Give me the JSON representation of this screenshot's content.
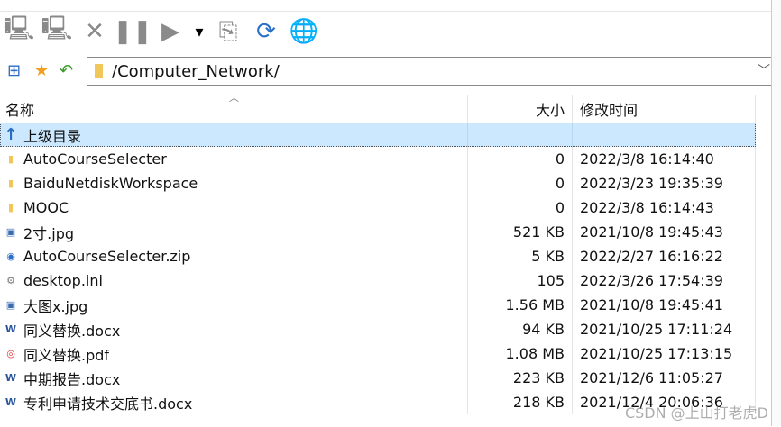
{
  "toolbar": {
    "buttons": [
      {
        "name": "connect-icon",
        "glyph": "🖳"
      },
      {
        "name": "disconnect-icon",
        "glyph": "🖳"
      },
      {
        "name": "stop-icon",
        "glyph": "✕"
      },
      {
        "name": "pause-icon",
        "glyph": "❚❚"
      },
      {
        "name": "play-icon",
        "glyph": "▶"
      },
      {
        "name": "dropdown-arrow-icon",
        "glyph": "▾"
      },
      {
        "name": "transfer-icon",
        "glyph": "⎘"
      },
      {
        "name": "refresh-icon",
        "glyph": "⟳"
      },
      {
        "name": "globe-icon",
        "glyph": "🌐"
      }
    ]
  },
  "address": {
    "path": "/Computer_Network/"
  },
  "columns": {
    "name": "名称",
    "size": "大小",
    "modified": "修改时间"
  },
  "parent": "上级目录",
  "files": [
    {
      "name": "AutoCourseSelecter",
      "size": "0",
      "modified": "2022/3/8 16:14:40",
      "type": "folder"
    },
    {
      "name": "BaiduNetdiskWorkspace",
      "size": "0",
      "modified": "2022/3/23 19:35:39",
      "type": "folder"
    },
    {
      "name": "MOOC",
      "size": "0",
      "modified": "2022/3/8 16:14:43",
      "type": "folder"
    },
    {
      "name": "2寸.jpg",
      "size": "521 KB",
      "modified": "2021/10/8 19:45:43",
      "type": "image"
    },
    {
      "name": "AutoCourseSelecter.zip",
      "size": "5 KB",
      "modified": "2022/2/27 16:16:22",
      "type": "zip"
    },
    {
      "name": "desktop.ini",
      "size": "105",
      "modified": "2022/3/26 17:54:39",
      "type": "ini"
    },
    {
      "name": "大图x.jpg",
      "size": "1.56 MB",
      "modified": "2021/10/8 19:45:41",
      "type": "image"
    },
    {
      "name": "同义替换.docx",
      "size": "94 KB",
      "modified": "2021/10/25 17:11:24",
      "type": "word"
    },
    {
      "name": "同义替换.pdf",
      "size": "1.08 MB",
      "modified": "2021/10/25 17:13:15",
      "type": "pdf"
    },
    {
      "name": "中期报告.docx",
      "size": "223 KB",
      "modified": "2021/12/6 11:05:27",
      "type": "word"
    },
    {
      "name": "专利申请技术交底书.docx",
      "size": "218 KB",
      "modified": "2021/12/4 20:06:36",
      "type": "word"
    }
  ],
  "watermark": "CSDN @上山打老虎D"
}
